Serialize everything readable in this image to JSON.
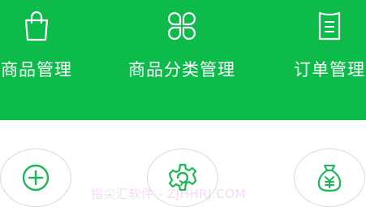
{
  "top_menu": {
    "items": [
      {
        "label": "商品管理",
        "icon": "shopping-bag-icon"
      },
      {
        "label": "商品分类管理",
        "icon": "category-clover-icon"
      },
      {
        "label": "订单管理",
        "icon": "order-document-icon"
      }
    ]
  },
  "action_buttons": [
    {
      "icon": "add-circle-icon"
    },
    {
      "icon": "gear-refresh-icon"
    },
    {
      "icon": "money-bag-yen-icon"
    }
  ],
  "watermark": "指尖汇软件 - ZJHHRJ.COM",
  "colors": {
    "accent_green": "#0dbb4a",
    "icon_green": "#19b955",
    "background": "#ffffff"
  }
}
